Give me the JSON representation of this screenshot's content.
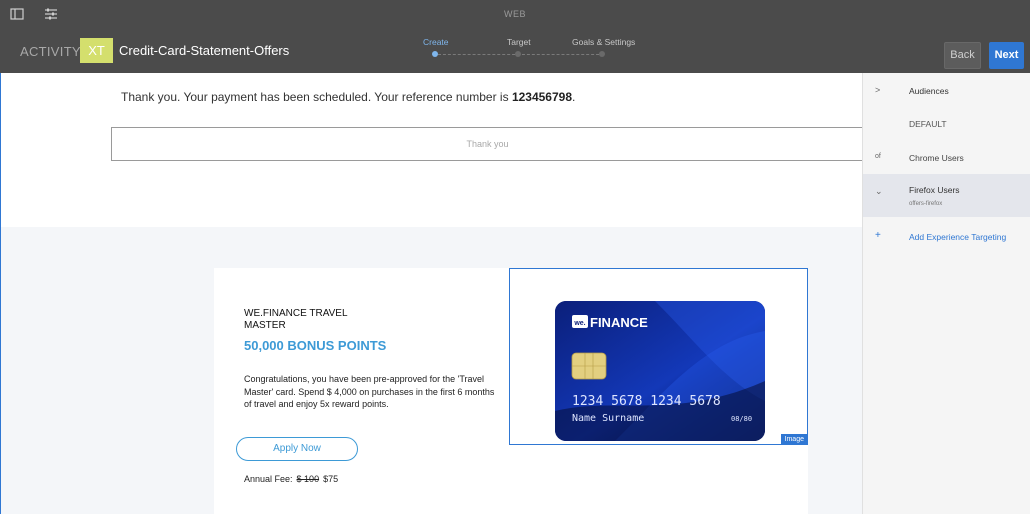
{
  "topbar": {
    "mode_label": "WEB",
    "activity_label": "ACTIVITY:",
    "activity_badge": "XT",
    "activity_name": "Credit-Card-Statement-Offers",
    "steps": [
      "Create",
      "Target",
      "Goals & Settings"
    ],
    "back_label": "Back",
    "next_label": "Next",
    "icons": [
      "sidebar-toggle-icon",
      "sliders-icon"
    ]
  },
  "page": {
    "thankyou_prefix": "Thank you. Your payment has been scheduled. Your reference number is ",
    "reference_number": "123456798",
    "thankyou_suffix": ".",
    "thankyou_box": "Thank you"
  },
  "offer": {
    "title": "WE.FINANCE TRAVEL MASTER",
    "points": "50,000 BONUS POINTS",
    "description": "Congratulations, you have been pre-approved for the 'Travel Master' card. Spend $ 4,000 on purchases in the first 6 months of travel and enjoy 5x reward points.",
    "apply_label": "Apply Now",
    "fee_label": "Annual Fee:",
    "fee_old": "$ 100",
    "fee_new": "$75",
    "image_tag": "Image",
    "card": {
      "brand_prefix": "we.",
      "brand": "FINANCE",
      "number": "1234  5678  1234  5678",
      "holder": "Name Surname",
      "expiry": "08/80"
    }
  },
  "rail": {
    "items": [
      {
        "icon": "chevron-right-icon",
        "icon_glyph": ">",
        "label": "Audiences"
      },
      {
        "label": "DEFAULT"
      },
      {
        "icon_glyph": "of",
        "label": "Chrome Users"
      },
      {
        "icon": "chevron-down-icon",
        "icon_glyph": "⌄",
        "label": "Firefox Users",
        "sub": "offers-firefox"
      },
      {
        "icon": "plus-icon",
        "icon_glyph": "+",
        "label": "Add Experience Targeting"
      }
    ]
  },
  "colors": {
    "topbar": "#4b4b4b",
    "accent": "#2f77d3",
    "badge": "#d4df6d",
    "offer_blue": "#3d9ad6"
  }
}
